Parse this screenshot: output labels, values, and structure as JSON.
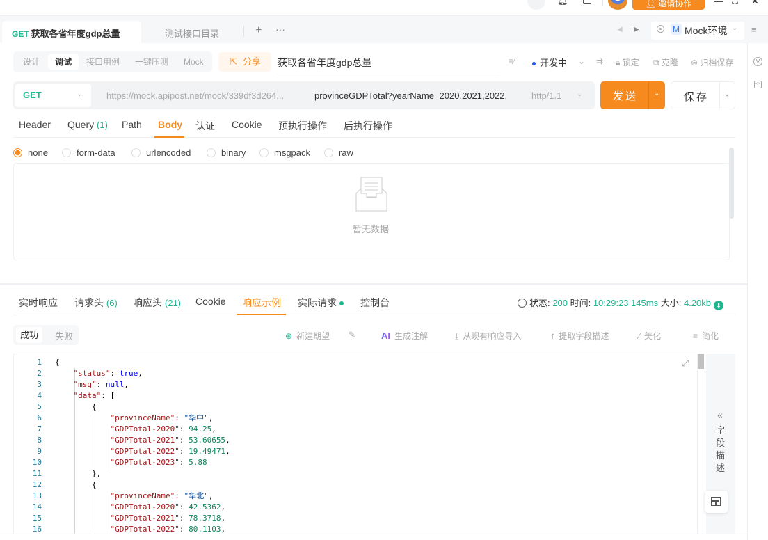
{
  "topbar": {
    "invite_label": "邀请协作",
    "window_controls": [
      "—",
      "⛶",
      "✕"
    ]
  },
  "tabbar": {
    "tabs": [
      {
        "method": "GET",
        "label": "获取各省年度gdp总量",
        "active": true
      },
      {
        "label": "测试接口目录",
        "active": false
      }
    ],
    "add_icon": "+",
    "more_icon": "···",
    "env": {
      "badge": "M",
      "label": "Mock环境"
    }
  },
  "toolbar": {
    "modes": [
      "设计",
      "调试",
      "接口用例",
      "一键压测",
      "Mock"
    ],
    "active_mode": "调试",
    "share_label": "分享",
    "api_name": "获取各省年度gdp总量",
    "status_label": "开发中",
    "lock_label": "锁定",
    "clone_label": "克隆",
    "archive_label": "归档保存"
  },
  "request": {
    "method": "GET",
    "url_base": "https://mock.apipost.net/mock/339df3d264...",
    "url_path": "provinceGDPTotal?yearName=2020,2021,2022,",
    "protocol": "http/1.1",
    "send_label": "发送",
    "save_label": "保存",
    "tabs": [
      {
        "label": "Header"
      },
      {
        "label": "Query",
        "count": "(1)"
      },
      {
        "label": "Path"
      },
      {
        "label": "Body",
        "active": true
      },
      {
        "label": "认证"
      },
      {
        "label": "Cookie"
      },
      {
        "label": "预执行操作"
      },
      {
        "label": "后执行操作"
      }
    ],
    "body_types": [
      "none",
      "form-data",
      "urlencoded",
      "binary",
      "msgpack",
      "raw"
    ],
    "body_selected": "none",
    "empty_text": "暂无数据"
  },
  "response": {
    "tabs": [
      {
        "label": "实时响应"
      },
      {
        "label": "请求头",
        "count": "(6)"
      },
      {
        "label": "响应头",
        "count": "(21)"
      },
      {
        "label": "Cookie"
      },
      {
        "label": "响应示例",
        "active": true
      },
      {
        "label": "实际请求",
        "dot": true
      },
      {
        "label": "控制台"
      }
    ],
    "status_label": "状态:",
    "status_value": "200",
    "time_label": "时间:",
    "time_value": "10:29:23",
    "duration_value": "145ms",
    "size_label": "大小:",
    "size_value": "4.20kb",
    "example_tabs": [
      "成功",
      "失败"
    ],
    "tools": [
      "新建期望",
      "生成注解",
      "从现有响应导入",
      "提取字段描述",
      "美化",
      "简化"
    ],
    "ai_label": "AI",
    "field_panel_label": "字段描述",
    "code_lines": [
      {
        "n": "1",
        "t": [
          [
            "p",
            "{"
          ]
        ]
      },
      {
        "n": "2",
        "t": [
          [
            "p",
            "    "
          ],
          [
            "k",
            "\"status\""
          ],
          [
            "p",
            ": "
          ],
          [
            "b",
            "true"
          ],
          [
            "p",
            ","
          ]
        ]
      },
      {
        "n": "3",
        "t": [
          [
            "p",
            "    "
          ],
          [
            "k",
            "\"msg\""
          ],
          [
            "p",
            ": "
          ],
          [
            "b",
            "null"
          ],
          [
            "p",
            ","
          ]
        ]
      },
      {
        "n": "4",
        "t": [
          [
            "p",
            "    "
          ],
          [
            "k",
            "\"data\""
          ],
          [
            "p",
            ": ["
          ]
        ]
      },
      {
        "n": "5",
        "t": [
          [
            "p",
            "        {"
          ]
        ]
      },
      {
        "n": "6",
        "t": [
          [
            "p",
            "            "
          ],
          [
            "k",
            "\"provinceName\""
          ],
          [
            "p",
            ": "
          ],
          [
            "s",
            "\"华中\""
          ],
          [
            "p",
            ","
          ]
        ]
      },
      {
        "n": "7",
        "t": [
          [
            "p",
            "            "
          ],
          [
            "k",
            "\"GDPTotal-2020\""
          ],
          [
            "p",
            ": "
          ],
          [
            "n",
            "94.25"
          ],
          [
            "p",
            ","
          ]
        ]
      },
      {
        "n": "8",
        "t": [
          [
            "p",
            "            "
          ],
          [
            "k",
            "\"GDPTotal-2021\""
          ],
          [
            "p",
            ": "
          ],
          [
            "n",
            "53.60655"
          ],
          [
            "p",
            ","
          ]
        ]
      },
      {
        "n": "9",
        "t": [
          [
            "p",
            "            "
          ],
          [
            "k",
            "\"GDPTotal-2022\""
          ],
          [
            "p",
            ": "
          ],
          [
            "n",
            "19.49471"
          ],
          [
            "p",
            ","
          ]
        ]
      },
      {
        "n": "10",
        "t": [
          [
            "p",
            "            "
          ],
          [
            "k",
            "\"GDPTotal-2023\""
          ],
          [
            "p",
            ": "
          ],
          [
            "n",
            "5.88"
          ]
        ]
      },
      {
        "n": "11",
        "t": [
          [
            "p",
            "        },"
          ]
        ]
      },
      {
        "n": "12",
        "t": [
          [
            "p",
            "        {"
          ]
        ]
      },
      {
        "n": "13",
        "t": [
          [
            "p",
            "            "
          ],
          [
            "k",
            "\"provinceName\""
          ],
          [
            "p",
            ": "
          ],
          [
            "s",
            "\"华北\""
          ],
          [
            "p",
            ","
          ]
        ]
      },
      {
        "n": "14",
        "t": [
          [
            "p",
            "            "
          ],
          [
            "k",
            "\"GDPTotal-2020\""
          ],
          [
            "p",
            ": "
          ],
          [
            "n",
            "42.5362"
          ],
          [
            "p",
            ","
          ]
        ]
      },
      {
        "n": "15",
        "t": [
          [
            "p",
            "            "
          ],
          [
            "k",
            "\"GDPTotal-2021\""
          ],
          [
            "p",
            ": "
          ],
          [
            "n",
            "78.3718"
          ],
          [
            "p",
            ","
          ]
        ]
      },
      {
        "n": "16",
        "t": [
          [
            "p",
            "            "
          ],
          [
            "k",
            "\"GDPTotal-2022\""
          ],
          [
            "p",
            ": "
          ],
          [
            "n",
            "80.1103"
          ],
          [
            "p",
            ","
          ]
        ]
      }
    ]
  },
  "colors": {
    "accent": "#f68a1e",
    "success": "#1fb58f",
    "status_dot": "#2356f6"
  }
}
